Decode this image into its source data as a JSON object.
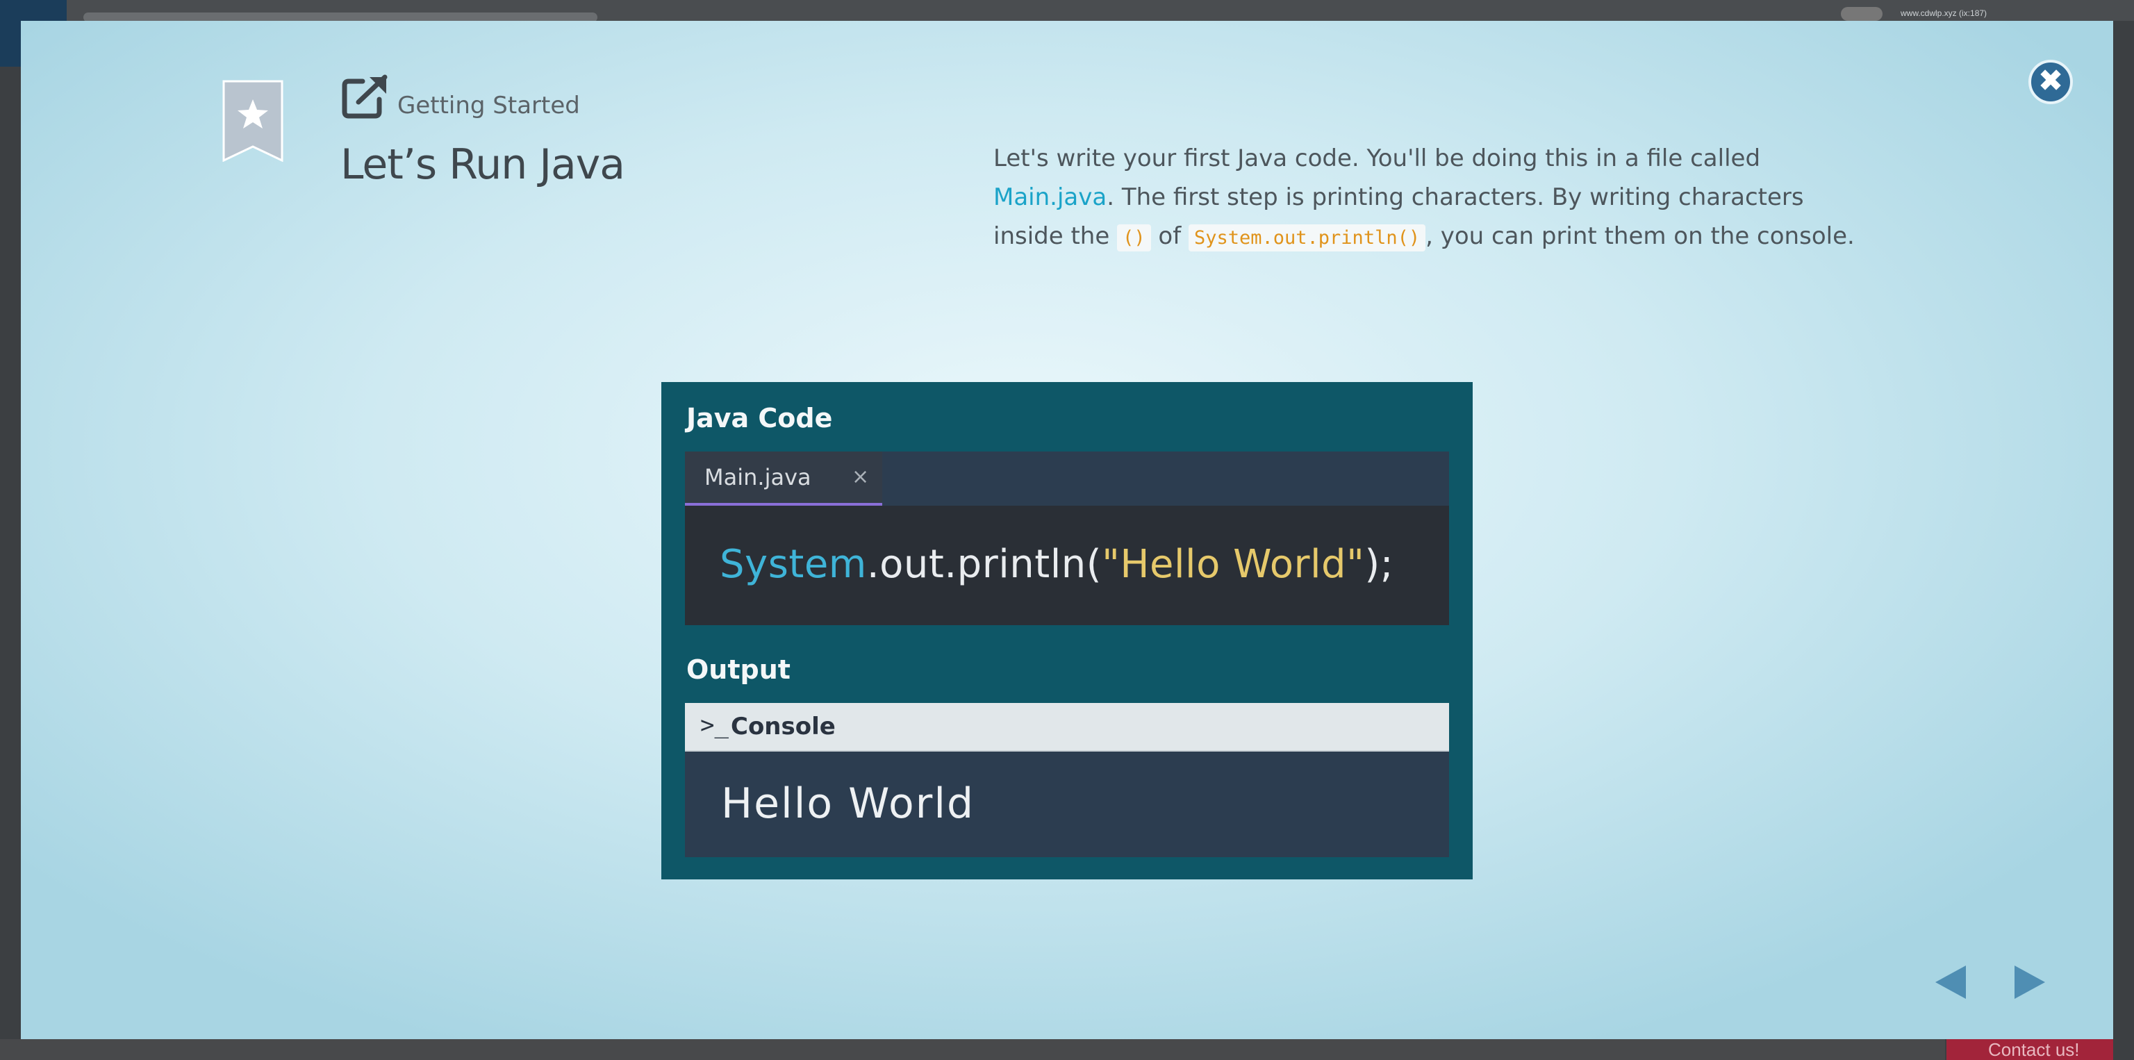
{
  "background": {
    "url_text": "www.cdwlp.xyz (ix:187)",
    "contact_label": "Contact us!"
  },
  "lesson": {
    "category": "Getting Started",
    "title": "Let’s Run Java",
    "description": {
      "part1": "Let's write your first Java code. You'll be doing this in a file called ",
      "link": "Main.java",
      "part2": ". The first step is printing characters. By writing characters inside the ",
      "code1": "()",
      "part3": " of ",
      "code2": "System.out.println()",
      "part4": ", you can print them on the console."
    }
  },
  "illustration": {
    "code_section_label": "Java Code",
    "file_tab": "Main.java",
    "tab_close": "×",
    "code": {
      "class_name": "System",
      "rest_before": ".out.println(",
      "string": "\"Hello World\"",
      "rest_after": ");"
    },
    "output_section_label": "Output",
    "console_prompt": ">_",
    "console_label": "Console",
    "console_output": "Hello World"
  },
  "controls": {
    "close_glyph": "✖"
  },
  "colors": {
    "accent_link": "#1aa3c8",
    "close_button": "#2f6a96",
    "nav_arrows": "#4f8eb3",
    "panel_teal": "#0e5767",
    "code_string": "#e6c96b",
    "code_class": "#3fb4d8",
    "inline_code": "#e0931b"
  }
}
